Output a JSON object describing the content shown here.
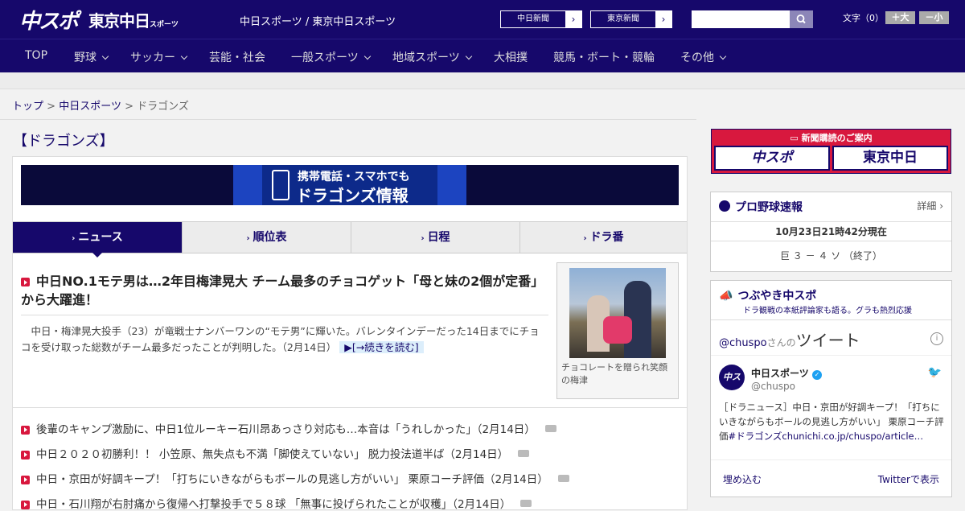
{
  "header": {
    "logo_chuspo": "中スポ",
    "logo_tokyo": "東京中日",
    "logo_tokyo_small": "スポーツ",
    "tagline": "中日スポーツ / 東京中日スポーツ",
    "paper_links": [
      {
        "label": "中日新聞",
        "arrow": "›"
      },
      {
        "label": "東京新聞",
        "arrow": "›"
      }
    ],
    "search": {
      "placeholder": "",
      "button_icon": "search-icon"
    },
    "font_size_label": "文字（0）",
    "font_bigger": "＋大",
    "font_smaller": "－小"
  },
  "nav": {
    "items": [
      {
        "label": "TOP",
        "has_menu": false
      },
      {
        "label": "野球",
        "has_menu": true
      },
      {
        "label": "サッカー",
        "has_menu": true
      },
      {
        "label": "芸能・社会",
        "has_menu": false
      },
      {
        "label": "一般スポーツ",
        "has_menu": true
      },
      {
        "label": "地域スポーツ",
        "has_menu": true
      },
      {
        "label": "大相撲",
        "has_menu": false
      },
      {
        "label": "競馬・ボート・競輪",
        "has_menu": false
      },
      {
        "label": "その他",
        "has_menu": true
      }
    ]
  },
  "breadcrumb": {
    "items": [
      "トップ",
      "中日スポーツ",
      "ドラゴンズ"
    ],
    "separator": ">"
  },
  "page_title": "【ドラゴンズ】",
  "banner": {
    "line1": "携帯電話・スマホでも",
    "line2": "ドラゴンズ情報"
  },
  "tabs": [
    {
      "label": "ニュース",
      "active": true
    },
    {
      "label": "順位表",
      "active": false
    },
    {
      "label": "日程",
      "active": false
    },
    {
      "label": "ドラ番",
      "active": false
    }
  ],
  "top_story": {
    "headline": "中日NO.1モテ男は…2年目梅津晃大 チーム最多のチョコゲット「母と妹の2個が定番」から大躍進！",
    "summary": "中日・梅津晃大投手（23）が竜戦士ナンバーワンの“モテ男”に輝いた。バレンタインデーだった14日までにチョコを受け取った総数がチーム最多だったことが判明した。（2月14日）",
    "read_more": "[→続きを読む]",
    "photo_caption": "チョコレートを贈られ笑顔の梅津"
  },
  "news_list": [
    {
      "text": "後輩のキャンプ激励に、中日1位ルーキー石川昂あっさり対応も…本音は「うれしかった」（2月14日）",
      "has_photo": true
    },
    {
      "text": "中日２０２０初勝利！！ 小笠原、無失点も不満「脚使えていない」 脱力投法道半ば（2月14日）",
      "has_photo": true
    },
    {
      "text": "中日・京田が好調キープ！「打ちにいきながらもボールの見逃し方がいい」 栗原コーチ評価（2月14日）",
      "has_photo": true
    },
    {
      "text": "中日・石川翔が右肘痛から復帰へ打撃投手で５８球 「無事に投げられたことが収穫」（2月14日）",
      "has_photo": true
    }
  ],
  "sidebar": {
    "subscribe_title": "新聞購読のご案内",
    "subscribe_logos": [
      "中スポ",
      "東京中日"
    ],
    "baseball_title": "プロ野球速報",
    "baseball_detail": "詳細 ›",
    "baseball_time": "10月23日21時42分現在",
    "baseball_score": "巨 ３ － ４ ソ （終了）",
    "tsubuyaki_title": "つぶやき中スポ",
    "tsubuyaki_sub": "ドラ観戦の本紙評論家も語る。グラも熱烈応援",
    "tweets_handle": "@chuspo",
    "tweets_suffix": "さんの",
    "tweets_label": "ツイート",
    "tweet_author": "中日スポーツ",
    "tweet_handle": "@chuspo",
    "tweet_text": "［ドラニュース］中日・京田が好調キープ！「打ちにいきながらもボールの見逃し方がいい」 栗原コーチ評価",
    "tweet_tag": "#ドラゴンズ",
    "tweet_link": "chunichi.co.jp/chuspo/article…",
    "embed_label": "埋め込む",
    "view_on_twitter": "Twitterで表示"
  },
  "colors": {
    "brand": "#16086b",
    "accent": "#d8183e"
  }
}
